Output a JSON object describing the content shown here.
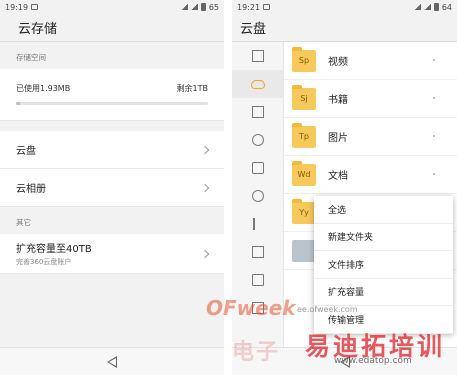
{
  "left": {
    "status": {
      "time": "19:19",
      "battery": "65"
    },
    "title": "云存储",
    "storage_label": "存储空间",
    "usage": {
      "used": "已使用1.93MB",
      "remaining": "剩余1TB",
      "fill_fraction": 0.02
    },
    "items": [
      {
        "label": "云盘"
      },
      {
        "label": "云相册"
      }
    ],
    "other_label": "其它",
    "expand": {
      "title": "扩充容量至40TB",
      "subtitle": "完善360云盘账户"
    }
  },
  "right": {
    "status": {
      "time": "19:21",
      "battery": "64"
    },
    "title": "云盘",
    "sidebar_icons": [
      "apps-icon",
      "cloud-icon",
      "image-icon",
      "clock-icon",
      "camera-icon",
      "download-icon",
      "music-icon",
      "picture-icon",
      "video-icon",
      "folder-icon"
    ],
    "files": [
      {
        "badge": "Sp",
        "name": "视频"
      },
      {
        "badge": "Sj",
        "name": "书籍"
      },
      {
        "badge": "Tp",
        "name": "图片"
      },
      {
        "badge": "Wd",
        "name": "文档"
      },
      {
        "badge": "Yy",
        "name": ""
      }
    ],
    "menu": [
      "全选",
      "新建文件夹",
      "文件排序",
      "扩充容量",
      "传输管理"
    ]
  },
  "watermark": {
    "brand": "OFweek",
    "url1": "ee.ofweek.com",
    "cn1": "电子",
    "cn2": "易迪拓培训",
    "url2": "www.edatop.com"
  },
  "colors": {
    "folder": "#f7c95a",
    "accent_cloud": "#f5a623",
    "watermark_red": "#dc2328"
  }
}
